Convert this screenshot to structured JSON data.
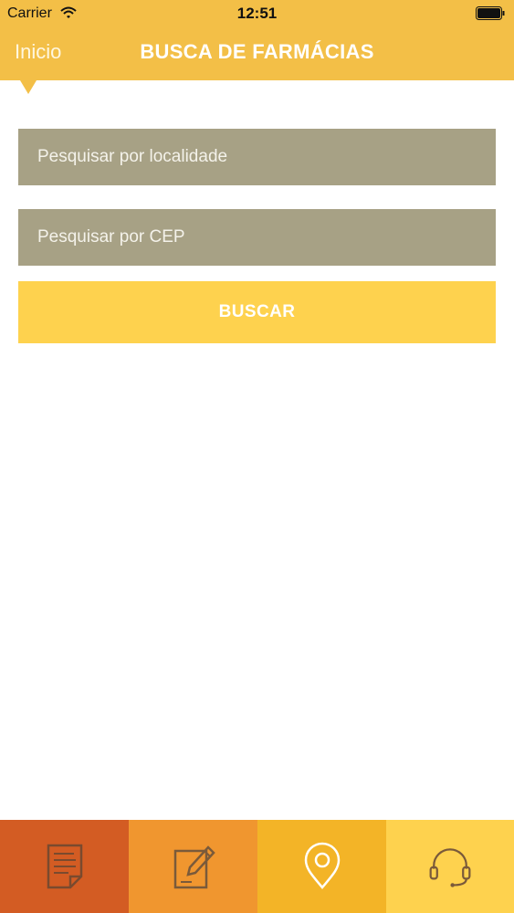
{
  "status_bar": {
    "carrier": "Carrier",
    "time": "12:51"
  },
  "nav": {
    "back_label": "Inicio",
    "title": "BUSCA DE FARMÁCIAS"
  },
  "form": {
    "localidade_placeholder": "Pesquisar por localidade",
    "cep_placeholder": "Pesquisar por CEP",
    "search_button_label": "BUSCAR"
  },
  "tabs": [
    {
      "icon": "document-icon",
      "color": "#d35c23"
    },
    {
      "icon": "edit-note-icon",
      "color": "#f0962f"
    },
    {
      "icon": "location-pin-icon",
      "color": "#f3b427"
    },
    {
      "icon": "headset-icon",
      "color": "#fed24e"
    }
  ],
  "colors": {
    "header": "#f3bf47",
    "field_bg": "#a7a185",
    "button_bg": "#fed24e",
    "tab_icon_stroke": "#7a5a3a"
  }
}
